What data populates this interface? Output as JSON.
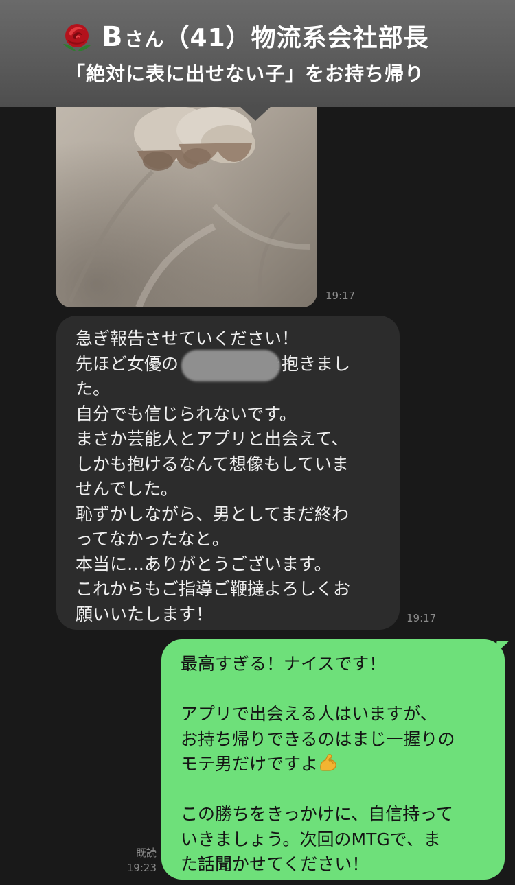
{
  "banner": {
    "title_b": "B",
    "title_san": "さん",
    "title_rest": "（41）物流系会社部長",
    "subtitle": "「絶対に表に出せない子」をお持ち帰り",
    "icon": "rose-icon"
  },
  "chat": {
    "photo_time": "19:17",
    "received": {
      "lines": [
        "急ぎ報告させていください！",
        "先ほど女優の　　　　　を抱きまし",
        "た。",
        "自分でも信じられないです。",
        "まさか芸能人とアプリと出会えて、",
        "しかも抱けるなんて想像もしていま",
        "せんでした。",
        "恥ずかしながら、男としてまだ終わ",
        "ってなかったなと。",
        "本当に…ありがとうございます。",
        "これからもご指導ご鞭撻よろしくお",
        "願いいたします！"
      ],
      "time": "19:17"
    },
    "sent": {
      "lines": [
        "最高すぎる！ナイスです！",
        "",
        "アプリで出会える人はいますが、",
        "お持ち帰りできるのはまじ一握りの",
        "モテ男だけですよ",
        "",
        "この勝ちをきっかけに、自信持って",
        "いきましょう。次回のMTGで、ま",
        "た話聞かせてください！"
      ],
      "emoji": "flexed-biceps-icon",
      "read_label": "既読",
      "time": "19:23"
    }
  },
  "colors": {
    "background": "#191919",
    "received_bubble": "#2c2c2c",
    "sent_bubble": "#6ee07a",
    "timestamp": "#8a8a8a"
  }
}
